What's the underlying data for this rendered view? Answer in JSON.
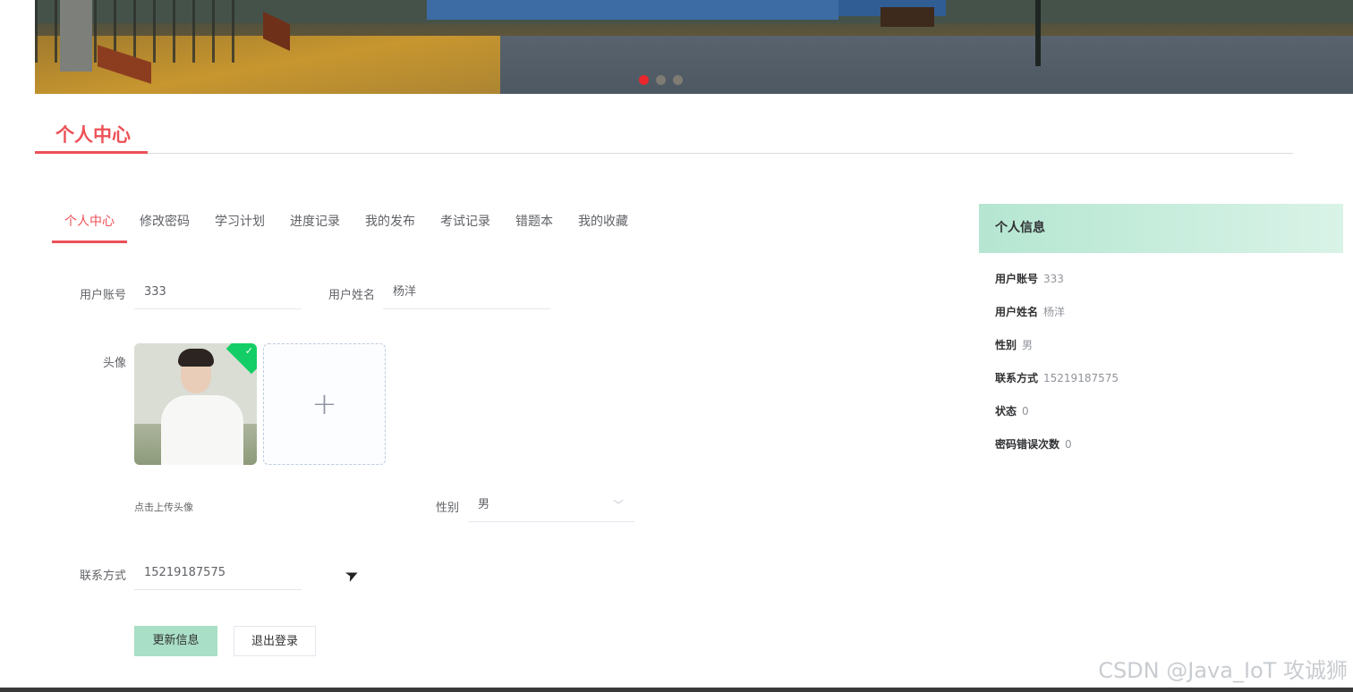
{
  "banner": {
    "active_slide": 1,
    "slide_count": 3
  },
  "section": {
    "title": "个人中心"
  },
  "tabs": [
    {
      "label": "个人中心",
      "active": true
    },
    {
      "label": "修改密码"
    },
    {
      "label": "学习计划"
    },
    {
      "label": "进度记录"
    },
    {
      "label": "我的发布"
    },
    {
      "label": "考试记录"
    },
    {
      "label": "错题本"
    },
    {
      "label": "我的收藏"
    }
  ],
  "form": {
    "account_label": "用户账号",
    "account_value": "333",
    "name_label": "用户姓名",
    "name_value": "杨洋",
    "avatar_label": "头像",
    "upload_plus": "+",
    "upload_hint": "点击上传头像",
    "gender_label": "性别",
    "gender_value": "男",
    "contact_label": "联系方式",
    "contact_value": "15219187575",
    "update_button": "更新信息",
    "logout_button": "退出登录"
  },
  "info": {
    "title": "个人信息",
    "rows": [
      {
        "key": "用户账号",
        "value": "333"
      },
      {
        "key": "用户姓名",
        "value": "杨洋"
      },
      {
        "key": "性别",
        "value": "男"
      },
      {
        "key": "联系方式",
        "value": "15219187575"
      },
      {
        "key": "状态",
        "value": "0"
      },
      {
        "key": "密码错误次数",
        "value": "0"
      }
    ]
  },
  "watermark": "CSDN @Java_IoT 攻诚狮",
  "colors": {
    "accent": "#ed5057",
    "success": "#13ce66",
    "primary_button": "#a9dfc6"
  }
}
